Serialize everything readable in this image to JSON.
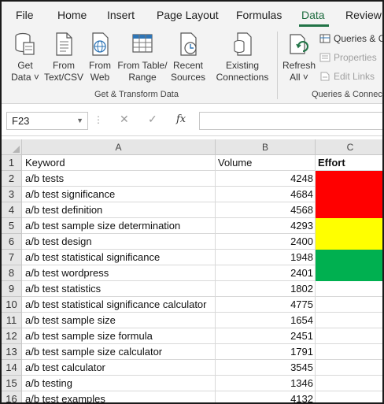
{
  "tabs": [
    {
      "label": "File",
      "active": false
    },
    {
      "label": "Home",
      "active": false
    },
    {
      "label": "Insert",
      "active": false
    },
    {
      "label": "Page Layout",
      "active": false
    },
    {
      "label": "Formulas",
      "active": false
    },
    {
      "label": "Data",
      "active": true
    },
    {
      "label": "Review",
      "active": false
    }
  ],
  "ribbon": {
    "get_data": {
      "line1": "Get",
      "line2": "Data ˅"
    },
    "from_text_csv": {
      "line1": "From",
      "line2": "Text/CSV"
    },
    "from_web": {
      "line1": "From",
      "line2": "Web"
    },
    "from_table_range": {
      "line1": "From Table/",
      "line2": "Range"
    },
    "recent_sources": {
      "line1": "Recent",
      "line2": "Sources"
    },
    "existing_connections": {
      "line1": "Existing",
      "line2": "Connections"
    },
    "refresh_all": {
      "line1": "Refresh",
      "line2": "All ˅"
    },
    "queries_connections": "Queries & C",
    "properties": "Properties",
    "edit_links": "Edit Links",
    "group_get_transform": "Get & Transform Data",
    "group_queries": "Queries & Connec"
  },
  "formula_bar": {
    "name_box": "F23",
    "cancel_symbol": "✕",
    "enter_symbol": "✓",
    "fx_label": "fx",
    "value": ""
  },
  "columns": [
    "A",
    "B",
    "C"
  ],
  "colors": {
    "accent": "#217346",
    "effort_red": "#ff0000",
    "effort_yellow": "#ffff00",
    "effort_green": "#00b050"
  },
  "rows": [
    {
      "num": "1",
      "keyword": "Keyword",
      "volume": "Volume",
      "effort": "Effort",
      "effort_color": "",
      "header": true
    },
    {
      "num": "2",
      "keyword": "a/b tests",
      "volume": "4248",
      "effort": "",
      "effort_color": "red"
    },
    {
      "num": "3",
      "keyword": "a/b test significance",
      "volume": "4684",
      "effort": "",
      "effort_color": "red"
    },
    {
      "num": "4",
      "keyword": "a/b test definition",
      "volume": "4568",
      "effort": "",
      "effort_color": "red"
    },
    {
      "num": "5",
      "keyword": "a/b test sample size determination",
      "volume": "4293",
      "effort": "",
      "effort_color": "yellow"
    },
    {
      "num": "6",
      "keyword": "a/b test design",
      "volume": "2400",
      "effort": "",
      "effort_color": "yellow"
    },
    {
      "num": "7",
      "keyword": "a/b test statistical significance",
      "volume": "1948",
      "effort": "",
      "effort_color": "green"
    },
    {
      "num": "8",
      "keyword": "a/b test wordpress",
      "volume": "2401",
      "effort": "",
      "effort_color": "green"
    },
    {
      "num": "9",
      "keyword": "a/b test statistics",
      "volume": "1802",
      "effort": "",
      "effort_color": ""
    },
    {
      "num": "10",
      "keyword": "a/b test statistical significance calculator",
      "volume": "4775",
      "effort": "",
      "effort_color": ""
    },
    {
      "num": "11",
      "keyword": "a/b test sample size",
      "volume": "1654",
      "effort": "",
      "effort_color": ""
    },
    {
      "num": "12",
      "keyword": "a/b test sample size formula",
      "volume": "2451",
      "effort": "",
      "effort_color": ""
    },
    {
      "num": "13",
      "keyword": "a/b test sample size calculator",
      "volume": "1791",
      "effort": "",
      "effort_color": ""
    },
    {
      "num": "14",
      "keyword": "a/b test calculator",
      "volume": "3545",
      "effort": "",
      "effort_color": ""
    },
    {
      "num": "15",
      "keyword": "a/b testing",
      "volume": "1346",
      "effort": "",
      "effort_color": ""
    },
    {
      "num": "16",
      "keyword": "a/b test examples",
      "volume": "4132",
      "effort": "",
      "effort_color": ""
    }
  ]
}
